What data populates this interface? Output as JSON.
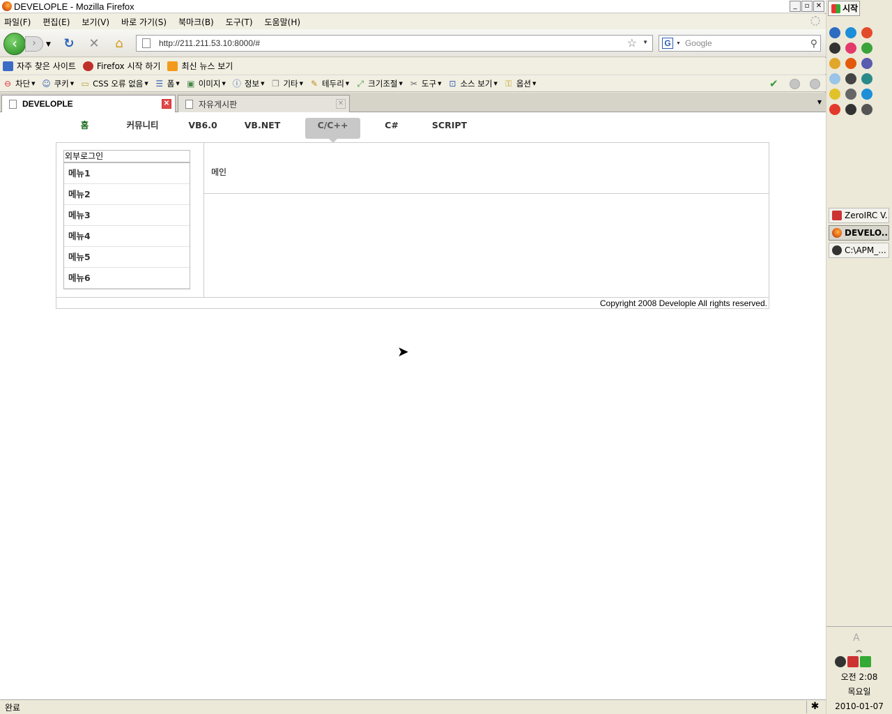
{
  "window": {
    "title": "DEVELOPLE - Mozilla Firefox",
    "min": "_",
    "max": "▫",
    "close": "✕"
  },
  "menu": [
    "파일(F)",
    "편집(E)",
    "보기(V)",
    "바로 가기(S)",
    "북마크(B)",
    "도구(T)",
    "도움말(H)"
  ],
  "nav": {
    "url": "http://211.211.53.10:8000/#",
    "search_placeholder": "Google",
    "search_engine": "G"
  },
  "bookmarks": [
    {
      "label": "자주 찾은 사이트",
      "color": "#3b6cc5"
    },
    {
      "label": "Firefox 시작 하기",
      "color": "#c0302a"
    },
    {
      "label": "최신 뉴스 보기",
      "color": "#f39a1e"
    }
  ],
  "webdev": [
    {
      "label": "차단",
      "icon": "⊖"
    },
    {
      "label": "쿠키",
      "icon": "☺"
    },
    {
      "label": "CSS 오류 없음",
      "icon": "▭"
    },
    {
      "label": "폼",
      "icon": "☰"
    },
    {
      "label": "이미지",
      "icon": "▣"
    },
    {
      "label": "정보",
      "icon": "ⓘ"
    },
    {
      "label": "기타",
      "icon": "❒"
    },
    {
      "label": "테두리",
      "icon": "✎"
    },
    {
      "label": "크기조절",
      "icon": "⤢"
    },
    {
      "label": "도구",
      "icon": "✂"
    },
    {
      "label": "소스 보기",
      "icon": "⊡"
    },
    {
      "label": "옵션",
      "icon": "⚿"
    }
  ],
  "tabs": [
    {
      "label": "DEVELOPLE",
      "active": true
    },
    {
      "label": "자유게시판",
      "active": false
    }
  ],
  "site": {
    "topnav": [
      {
        "label": "홈",
        "width": 41
      },
      {
        "label": "커뮤니티",
        "width": 125
      },
      {
        "label": "VB6.0",
        "width": 48
      },
      {
        "label": "VB.NET",
        "width": 123
      },
      {
        "label": "C/C++",
        "width": 79,
        "active": true
      },
      {
        "label": "C#",
        "width": 90
      },
      {
        "label": "SCRIPT",
        "width": 76
      }
    ],
    "login_label": "외부로그인",
    "menu": [
      "메뉴1",
      "메뉴2",
      "메뉴3",
      "메뉴4",
      "메뉴5",
      "메뉴6"
    ],
    "main_label": "메인",
    "footer": "Copyright 2008 Develople All rights reserved."
  },
  "status": "완료",
  "taskbar": {
    "start": "시작",
    "quick_colors": [
      "#2d6cc0",
      "#1c8fd8",
      "#e24a2a",
      "#333",
      "#e23a6a",
      "#3aa33a",
      "#e2a62a",
      "#e25b0c",
      "#5a5ab0",
      "#9ac4e8",
      "#444",
      "#2a8a8a",
      "#e2c22a",
      "#666",
      "#1c8fd8",
      "#e23a2a",
      "#333",
      "#555"
    ],
    "buttons": [
      "ZeroIRC V...",
      "DEVELO...",
      "C:\\APM_..."
    ],
    "time": "오전 2:08",
    "day": "목요일",
    "date": "2010-01-07"
  }
}
